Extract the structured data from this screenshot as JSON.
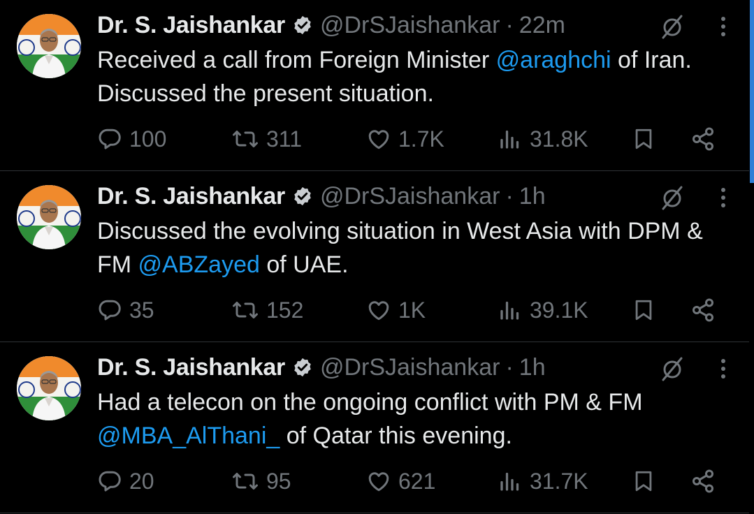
{
  "tweets": [
    {
      "name": "Dr. S. Jaishankar",
      "handle": "@DrSJaishankar",
      "separator": "·",
      "time": "22m",
      "text_before": "Received a call from Foreign Minister ",
      "mention": "@araghchi",
      "text_after": " of Iran. Discussed the present situation.",
      "replies": "100",
      "reposts": "311",
      "likes": "1.7K",
      "views": "31.8K"
    },
    {
      "name": "Dr. S. Jaishankar",
      "handle": "@DrSJaishankar",
      "separator": "·",
      "time": "1h",
      "text_before": "Discussed the evolving situation in West Asia with DPM & FM ",
      "mention": "@ABZayed",
      "text_after": " of UAE.",
      "replies": "35",
      "reposts": "152",
      "likes": "1K",
      "views": "39.1K"
    },
    {
      "name": "Dr. S. Jaishankar",
      "handle": "@DrSJaishankar",
      "separator": "·",
      "time": "1h",
      "text_before": "Had a telecon on the ongoing conflict with PM & FM ",
      "mention": "@MBA_AlThani_",
      "text_after": " of Qatar this evening.",
      "replies": "20",
      "reposts": "95",
      "likes": "621",
      "views": "31.7K"
    }
  ],
  "icons": {
    "verified": "verified-badge-icon",
    "grok": "grok-icon",
    "more": "more-options-icon",
    "reply": "reply-icon",
    "repost": "repost-icon",
    "like": "like-icon",
    "views": "views-icon",
    "bookmark": "bookmark-icon",
    "share": "share-icon"
  },
  "colors": {
    "background": "#000000",
    "text": "#e7e9ea",
    "muted": "#71767b",
    "link": "#1d9bf0",
    "divider": "#2f3336"
  }
}
